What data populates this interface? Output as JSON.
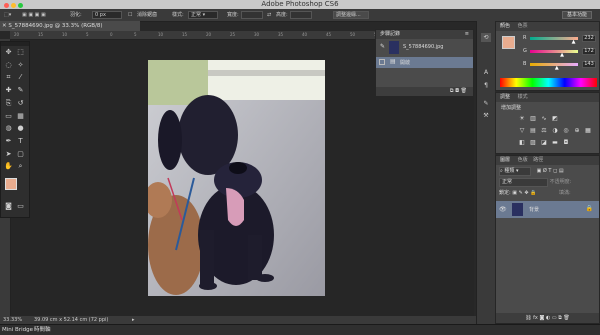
{
  "window": {
    "title": "Adobe Photoshop CS6"
  },
  "options_bar": {
    "feather_label": "羽化:",
    "feather_value": "0 px",
    "antialias_label": "消除鋸齒",
    "style_label": "樣式:",
    "style_value": "正常",
    "width_label": "寬度:",
    "height_label": "高度:",
    "refine_edge_label": "調整邊緣...",
    "workspace_label": "基本功能"
  },
  "document": {
    "tab_label": "S_57884690.jpg @ 33.3% (RGB/8)",
    "zoom": "33.33%",
    "doc_size": "39.09 cm x 52.14 cm (72 ppi)"
  },
  "ruler_ticks": [
    "20",
    "15",
    "10",
    "5",
    "0",
    "5",
    "10",
    "15",
    "20",
    "25",
    "30",
    "35",
    "40",
    "45",
    "50",
    "55",
    "60",
    "65",
    "70"
  ],
  "bottom_bar": {
    "mini_bridge": "Mini Bridge",
    "timeline": "時間軸"
  },
  "history_panel": {
    "tab": "步驟記錄",
    "snapshot": "S_57884690.jpg",
    "items": [
      "開啟"
    ]
  },
  "color_panel": {
    "tabs": [
      "顏色",
      "色票"
    ],
    "channels": [
      {
        "name": "R",
        "value": "232",
        "fraction": 0.91
      },
      {
        "name": "G",
        "value": "172",
        "fraction": 0.67
      },
      {
        "name": "B",
        "value": "143",
        "fraction": 0.56
      }
    ],
    "foreground": "#e8ac8f"
  },
  "adjustments_panel": {
    "tabs": [
      "調整",
      "樣式"
    ],
    "add_label": "增加調整"
  },
  "layers_panel": {
    "tabs": [
      "圖層",
      "色版",
      "路徑"
    ],
    "kind_label": "種類",
    "blend_mode": "正常",
    "opacity_label": "不透明度:",
    "lock_label": "鎖定:",
    "fill_label": "填滿:",
    "layer_name": "背景"
  }
}
